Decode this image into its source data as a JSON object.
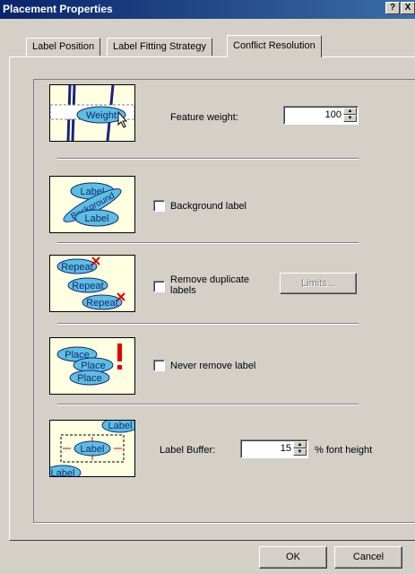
{
  "window": {
    "title": "Placement Properties",
    "help_btn": "?",
    "close_btn": "X"
  },
  "tabs": [
    {
      "label": "Label Position"
    },
    {
      "label": "Label Fitting Strategy"
    },
    {
      "label": "Conflict Resolution"
    }
  ],
  "feature_weight": {
    "label": "Feature weight:",
    "value": "100",
    "thumb_text": "Weight"
  },
  "background_label": {
    "label": "Background label",
    "checked": false,
    "thumb_texts": [
      "Label",
      "Background",
      "Label"
    ]
  },
  "remove_duplicate": {
    "label_line1": "Remove duplicate",
    "label_line2": "labels",
    "checked": false,
    "limits_button": "Limits...",
    "thumb_texts": [
      "Repeat",
      "Repeat",
      "Repeat"
    ]
  },
  "never_remove": {
    "label": "Never remove label",
    "checked": false,
    "thumb_texts": [
      "Place",
      "Place",
      "Place"
    ]
  },
  "label_buffer": {
    "label": "Label Buffer:",
    "value": "15",
    "unit": "% font height",
    "thumb_texts": [
      "Label",
      "Label",
      "Label"
    ]
  },
  "buttons": {
    "ok": "OK",
    "cancel": "Cancel"
  },
  "colors": {
    "titlebar": "#0a246a",
    "face": "#d4d0c8",
    "thumb_bg": "#ffffe1",
    "label_fill": "#5bc0de",
    "accent_red": "#e00000"
  }
}
